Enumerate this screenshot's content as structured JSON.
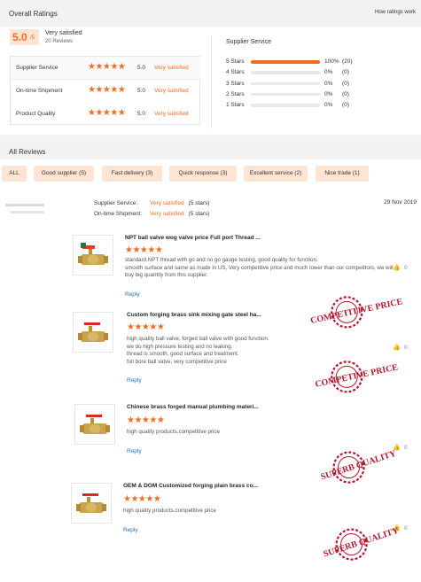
{
  "overall": {
    "title": "Overall Ratings",
    "how_link": "How ratings work",
    "score": "5.0",
    "score_denom": "/5",
    "verdict": "Very satisfied",
    "reviews_count": "20 Reviews"
  },
  "metrics": [
    {
      "label": "Supplier Service",
      "stars": "★★★★★",
      "score": "5.0",
      "text": "Very satisfied"
    },
    {
      "label": "On-time Shipment",
      "stars": "★★★★★",
      "score": "5.0",
      "text": "Very satisfied"
    },
    {
      "label": "Product Quality",
      "stars": "★★★★★",
      "score": "5.0",
      "text": "Very satisfied"
    }
  ],
  "supplier_service": {
    "title": "Supplier Service",
    "rows": [
      {
        "label": "5 Stars",
        "fraction": 1.0,
        "pct": "100%",
        "count": "(20)"
      },
      {
        "label": "4 Stars",
        "fraction": 0,
        "pct": "0%",
        "count": "(0)"
      },
      {
        "label": "3 Stars",
        "fraction": 0,
        "pct": "0%",
        "count": "(0)"
      },
      {
        "label": "2 Stars",
        "fraction": 0,
        "pct": "0%",
        "count": "(0)"
      },
      {
        "label": "1 Stars",
        "fraction": 0,
        "pct": "0%",
        "count": "(0)"
      }
    ]
  },
  "all_reviews": {
    "title": "All Reviews",
    "filters": [
      "ALL",
      "Good supplier (5)",
      "Fast delivery (3)",
      "Quick response (3)",
      "Excellent service (2)",
      "Nice trade (1)"
    ]
  },
  "review": {
    "date": "29 Nov 2019",
    "supplier_label": "Supplier Service:",
    "supplier_value": "Very satisfied",
    "supplier_stars": "(5 stars)",
    "shipment_label": "On-time Shipment:",
    "shipment_value": "Very satisfied",
    "shipment_stars": "(5 stars)"
  },
  "products": [
    {
      "title": "NPT ball valve wog valve price Full port Thread ...",
      "stars": "★★★★★",
      "body": "standard NPT thread with go and no go gauge testing, good quality for function.\nsmooth surface and same as made in US, Very competitive price and much lower than our competitors, we will buy big quantity from this supplier.",
      "reply": "Reply",
      "likes": "0",
      "stamp": "COMPETITIVE PRICE"
    },
    {
      "title": "Custom forging brass sink mixing gate steel ha...",
      "stars": "★★★★★",
      "body": "high quality ball valve, forged ball valve with good function.\nwe do high pressure testing and no leaking.\nthread is smooth, good surface and treatment.\nfull bore ball valve, very competitive price",
      "reply": "Reply",
      "likes": "0",
      "stamp": "COMPETIVE PRICE"
    },
    {
      "title": "Chinese brass forged manual plumbing materi...",
      "stars": "★★★★★",
      "body": "high quality products.competitive price",
      "reply": "Reply",
      "likes": "0",
      "stamp": "SUPERB QUALITY"
    },
    {
      "title": "OEM & DOM Customized forging plain brass co...",
      "stars": "★★★★★",
      "body": "high quality products.competitive price",
      "reply": "Reply",
      "likes": "0",
      "stamp": "SUPERB QUALITY"
    }
  ],
  "colors": {
    "accent": "#f26b22",
    "accent_light": "#fde4d3",
    "link": "#1f6fc5",
    "stamp": "#b3182e"
  }
}
